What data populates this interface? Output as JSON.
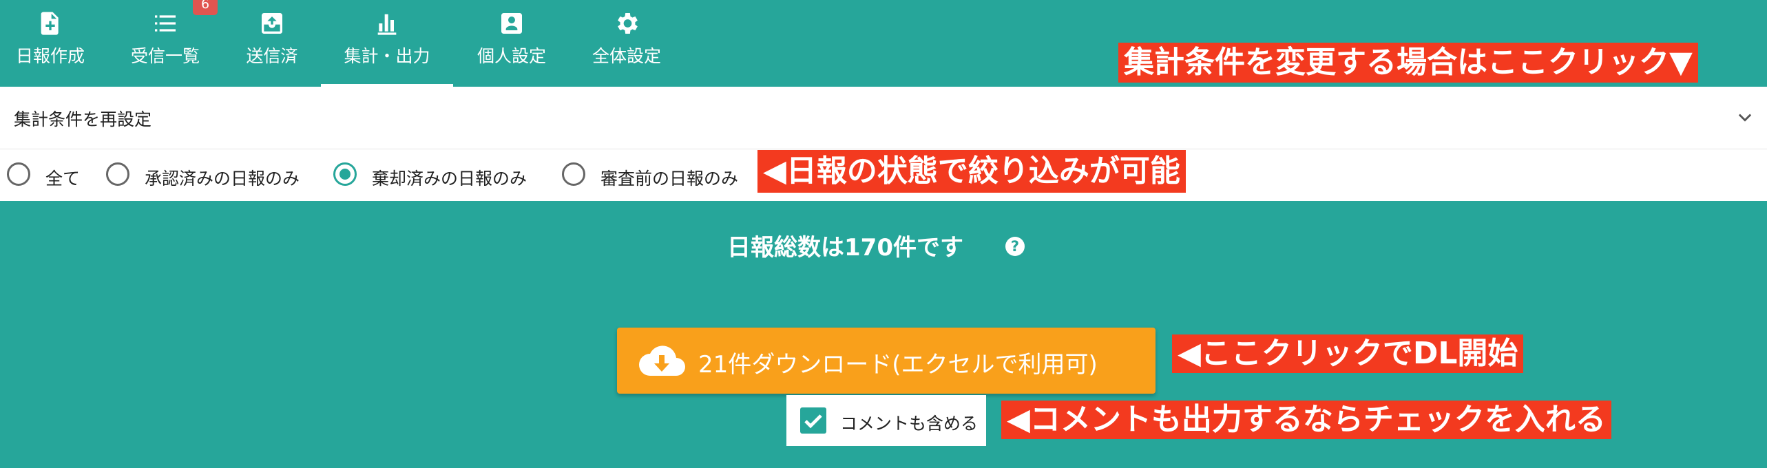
{
  "nav": {
    "tabs": [
      {
        "label": "日報作成",
        "icon": "file-plus-icon"
      },
      {
        "label": "受信一覧",
        "icon": "list-icon",
        "badge": "6"
      },
      {
        "label": "送信済",
        "icon": "archive-upload-icon"
      },
      {
        "label": "集計・出力",
        "icon": "bar-chart-icon",
        "active": true
      },
      {
        "label": "個人設定",
        "icon": "person-card-icon"
      },
      {
        "label": "全体設定",
        "icon": "gear-icon"
      }
    ]
  },
  "annotations": {
    "change_conditions": "集計条件を変更する場合はここクリック▼",
    "filter_status": "◀日報の状態で絞り込みが可能",
    "click_download": "◀ここクリックでDL開始",
    "include_comments": "◀コメントも出力するならチェックを入れる"
  },
  "panel": {
    "title": "集計条件を再設定",
    "radios": [
      {
        "label": "全て",
        "checked": false
      },
      {
        "label": "承認済みの日報のみ",
        "checked": false
      },
      {
        "label": "棄却済みの日報のみ",
        "checked": true
      },
      {
        "label": "審査前の日報のみ",
        "checked": false
      }
    ]
  },
  "main": {
    "total_text": "日報総数は170件です",
    "help_glyph": "?",
    "download_label": "21件ダウンロード(エクセルで利用可)",
    "include_comments_label": "コメントも含める",
    "include_comments_checked": true
  },
  "colors": {
    "primary": "#26a69a",
    "accent": "#f9a01b",
    "callout": "#f33a1f",
    "badge": "#e05550"
  }
}
